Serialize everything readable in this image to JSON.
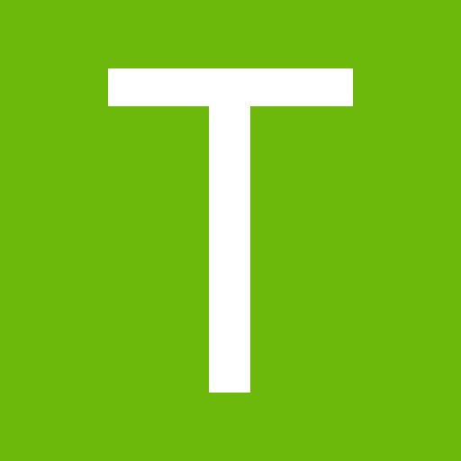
{
  "tile": {
    "letter": "T",
    "background_color": "#6cb90b",
    "letter_color": "#ffffff"
  }
}
